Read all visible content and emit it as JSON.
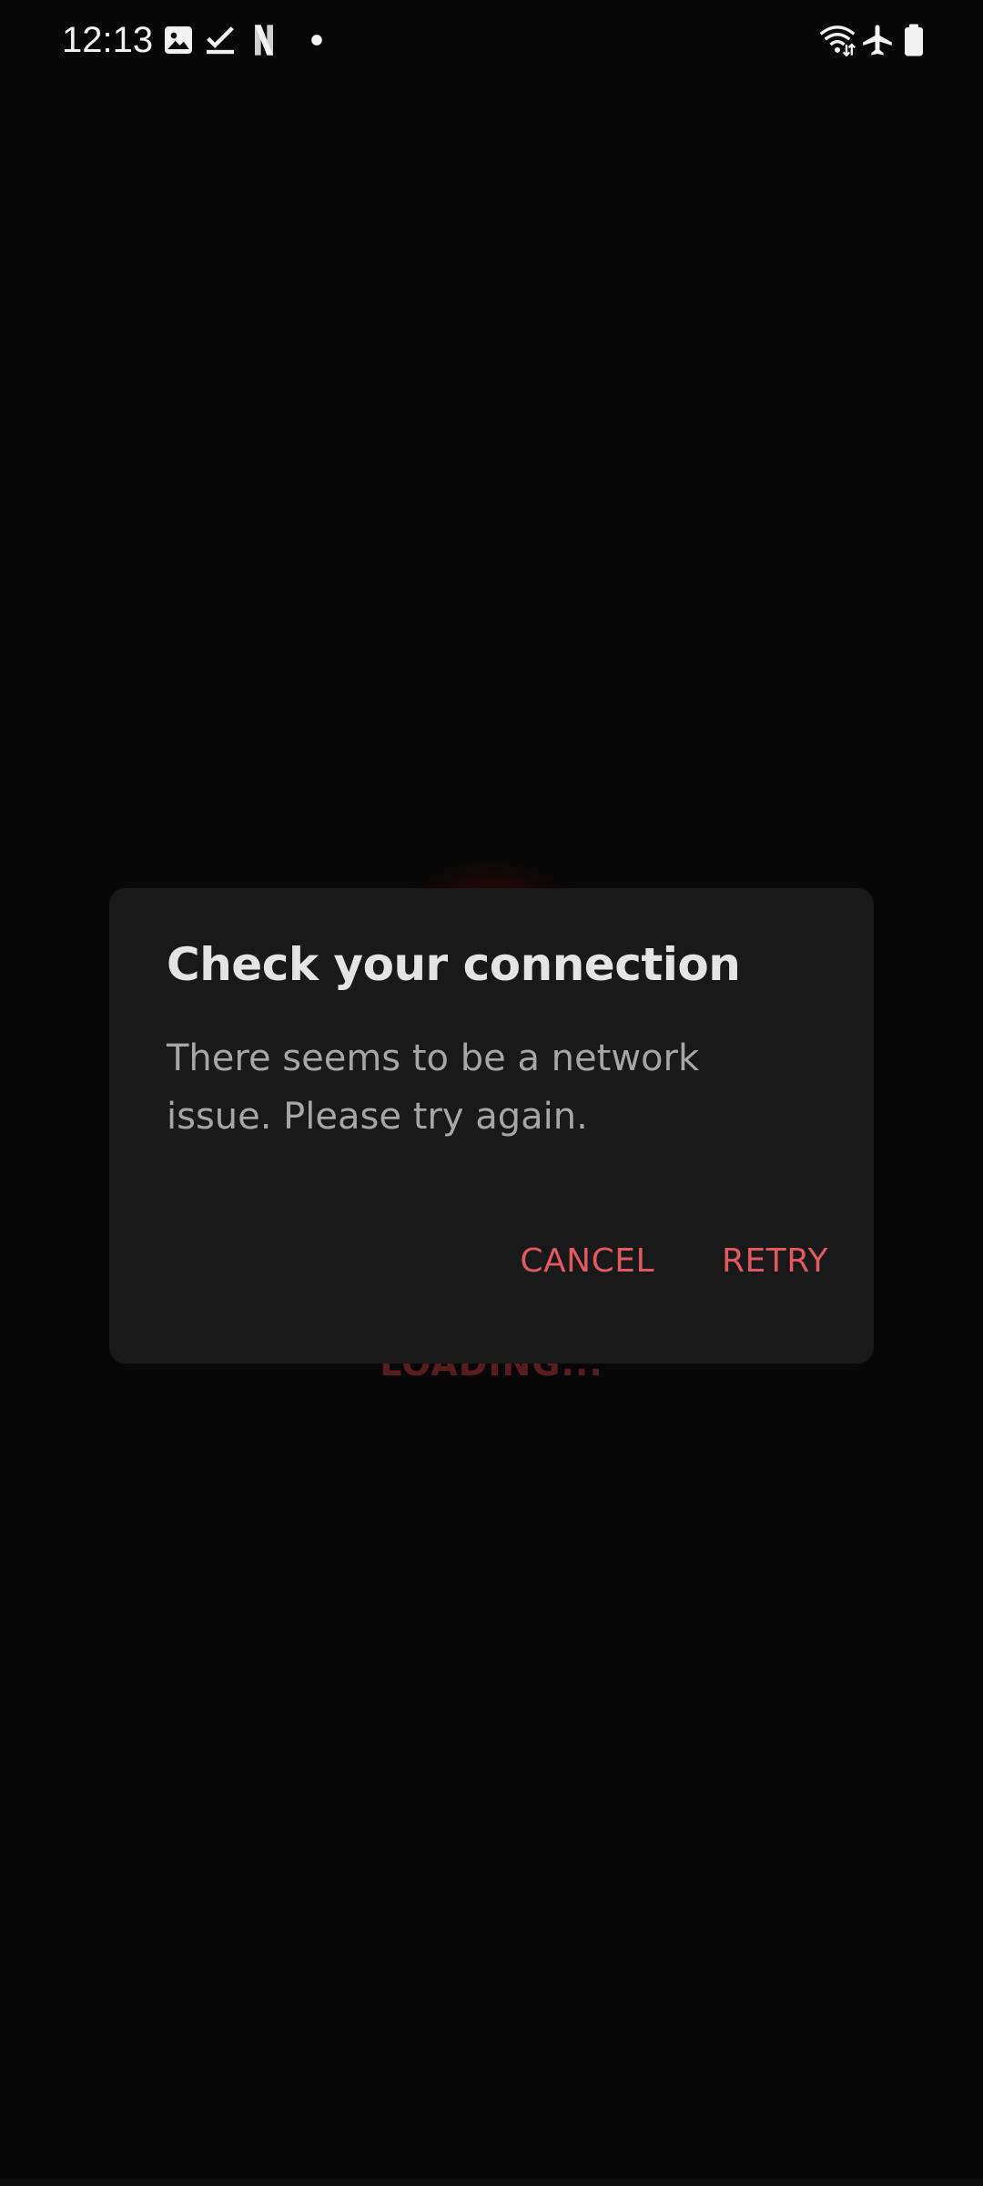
{
  "status_bar": {
    "time": "12:13",
    "left_icons": [
      "gallery-icon",
      "task-check-icon",
      "netflix-n-icon",
      "notification-dot-icon"
    ],
    "right_icons": [
      "wifi-data-icon",
      "airplane-mode-icon",
      "battery-icon"
    ],
    "netflix_letter": "N"
  },
  "background": {
    "loading_label": "LOADING...",
    "loader_color": "#7a0a0a"
  },
  "dialog": {
    "title": "Check your connection",
    "message": "There seems to be a network issue. Please try again.",
    "cancel_label": "CANCEL",
    "retry_label": "RETRY"
  },
  "colors": {
    "background": "#080808",
    "dialog_surface": "#191919",
    "accent": "#e05a5f",
    "title": "#e4e4e4",
    "body_text": "#a6a6a6"
  }
}
